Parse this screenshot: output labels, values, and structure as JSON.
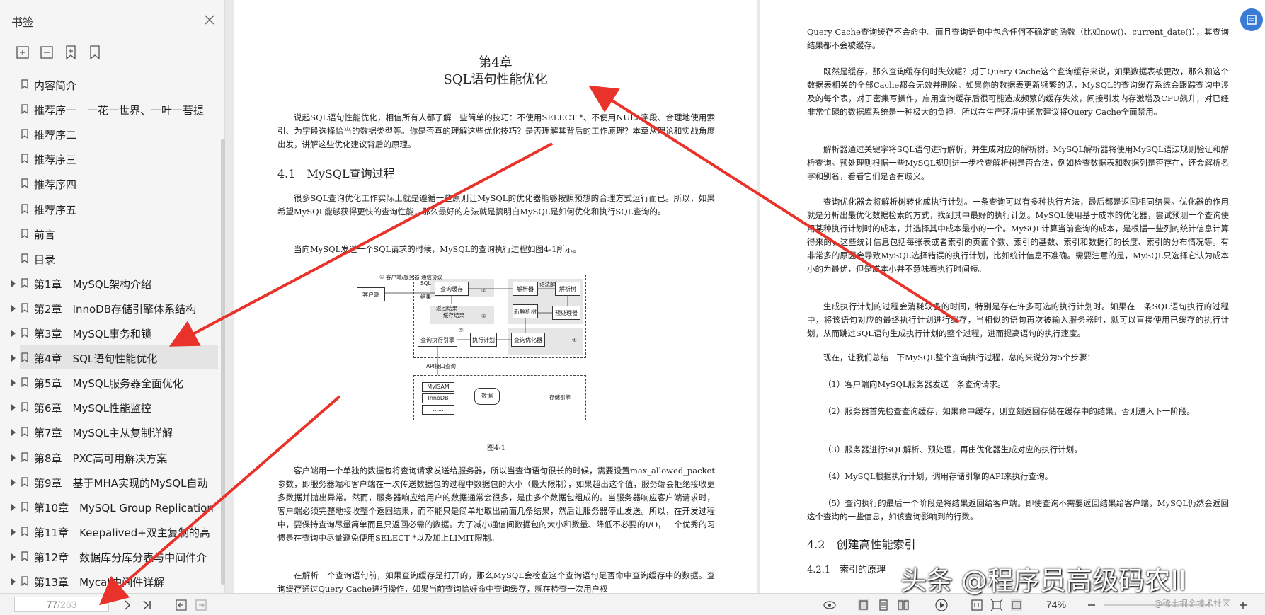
{
  "sidebar": {
    "title": "书签",
    "bookmarks": [
      {
        "label": "内容简介",
        "expandable": false
      },
      {
        "label": "推荐序一　一花一世界、一叶一菩提",
        "expandable": false
      },
      {
        "label": "推荐序二",
        "expandable": false
      },
      {
        "label": "推荐序三",
        "expandable": false
      },
      {
        "label": "推荐序四",
        "expandable": false
      },
      {
        "label": "推荐序五",
        "expandable": false
      },
      {
        "label": "前言",
        "expandable": false
      },
      {
        "label": "目录",
        "expandable": false
      },
      {
        "label": "第1章　MySQL架构介绍",
        "expandable": true
      },
      {
        "label": "第2章　InnoDB存储引擎体系结构",
        "expandable": true
      },
      {
        "label": "第3章　MySQL事务和锁",
        "expandable": true
      },
      {
        "label": "第4章　SQL语句性能优化",
        "expandable": true,
        "active": true
      },
      {
        "label": "第5章　MySQL服务器全面优化",
        "expandable": true
      },
      {
        "label": "第6章　MySQL性能监控",
        "expandable": true
      },
      {
        "label": "第7章　MySQL主从复制详解",
        "expandable": true
      },
      {
        "label": "第8章　PXC高可用解决方案",
        "expandable": true
      },
      {
        "label": "第9章　基于MHA实现的MySQL自动",
        "expandable": true
      },
      {
        "label": "第10章　MySQL Group Replication",
        "expandable": true
      },
      {
        "label": "第11章　Keepalived+双主复制的高",
        "expandable": true
      },
      {
        "label": "第12章　数据库分库分表与中间件介",
        "expandable": true
      },
      {
        "label": "第13章　Mycat中间件详解",
        "expandable": true
      }
    ]
  },
  "left_page": {
    "chapter": "第4章",
    "chapter_title": "SQL语句性能优化",
    "intro": "说起SQL语句性能优化，相信所有人都了解一些简单的技巧：不使用SELECT *、不使用NULL字段、合理地使用索引、为字段选择恰当的数据类型等。你是否真的理解这些优化技巧？是否理解其背后的工作原理？本章从理论和实战角度出发，讲解这些优化建议背后的原理。",
    "section": "4.1　MySQL查询过程",
    "para1": "很多SQL查询优化工作实际上就是遵循一些原则让MySQL的优化器能够按照预想的合理方式运行而已。所以，如果希望MySQL能够获得更快的查询性能，那么最好的方法就是搞明白MySQL是如何优化和执行SQL查询的。",
    "para2": "当向MySQL发送一个SQL请求的时候，MySQL的查询执行过程如图4-1所示。",
    "diagram": {
      "client": "客户端",
      "step1": "① 客户端/服务器 通信协议",
      "sql": "SQL",
      "result": "结果",
      "query_cache": "查询缓存",
      "parser": "解析器",
      "syntax_parse": "语法解析",
      "parse_tree": "解析树",
      "preprocessor": "预处理器",
      "new_parse_tree": "新解析树",
      "return_result": "返回结果",
      "cache_result": "缓存结果",
      "executor": "查询执行引擎",
      "plan": "执行计划",
      "optimizer": "查询优化器",
      "api": "API接口查询",
      "myisam": "MyISAM",
      "innodb": "InnoDB",
      "dots": "......",
      "data": "数据",
      "engine": "存储引擎",
      "n2": "②",
      "n3": "③",
      "n4": "④",
      "n5": "⑤",
      "n6": "⑥"
    },
    "caption": "图4-1",
    "para3": "客户端用一个单独的数据包将查询请求发送给服务器，所以当查询语句很长的时候，需要设置max_allowed_packet参数，即服务器端和客户端在一次传送数据包的过程中数据包的大小（最大限制），如果超出这个值，服务端会拒绝接收更多数据并抛出异常。然而，服务器响应给用户的数据通常会很多，是由多个数据包组成的。当服务器响应客户端请求时，客户端必须完整地接收整个返回结果，而不能只是简单地取出前面几条结果，然后让服务器停止发送。所以，在开发过程中，要保持查询尽量简单而且只返回必需的数据。为了减小通信间数据包的大小和数量、降低不必要的I/O，一个优秀的习惯是在查询中尽量避免使用SELECT *以及加上LIMIT限制。",
    "para4": "在解析一个查询语句前，如果查询缓存是打开的，那么MySQL会检查这个查询语句是否命中查询缓存中的数据。查询缓存通过Query Cache进行操作，如果当前查询恰好命中查询缓存，就在检查一次用户权"
  },
  "right_page": {
    "p0": "Query Cache查询缓存不会命中。而且查询语句中包含任何不确定的函数（比如now()、current_date()），其查询结果都不会被缓存。",
    "p1": "既然是缓存，那么查询缓存何时失效呢？对于Query Cache这个查询缓存来说，如果数据表被更改，那么和这个数据表相关的全部Cache都会无效并删除。如果你的数据表更新频繁的话，MySQL的查询缓存系统会跟踪查询中涉及的每个表，对于密集写操作，启用查询缓存后很可能造成频繁的缓存失效，间接引发内存激增及CPU飙升，对已经非常忙碌的数据库系统是一种极大的负担。所以在生产环境中通常建议将Query Cache全面禁用。",
    "p2": "解析器通过关键字将SQL语句进行解析，并生成对应的解析树。MySQL解析器将使用MySQL语法规则验证和解析查询。预处理则根据一些MySQL规则进一步检查解析树是否合法，例如检查数据表和数据列是否存在，还会解析名字和别名，看看它们是否有歧义。",
    "p3": "查询优化器会将解析树转化成执行计划。一条查询可以有多种执行方法，最后都是返回相同结果。优化器的作用就是分析出最优化数据检索的方式，找到其中最好的执行计划。MySQL使用基于成本的优化器，尝试预测一个查询使用某种执行计划时的成本，并选择其中成本最小的一个。MySQL计算当前查询的成本，是根据一些列的统计信息计算得来的，这些统计信息包括每张表或者索引的页面个数、索引的基数、索引和数据行的长度、索引的分布情况等。有非常多的原因会导致MySQL选择错误的执行计划，比如统计信息不准确。需要注意的是，MySQL只选择它认为成本小的为最优，但是成本小并不意味着执行时间短。",
    "p4": "生成执行计划的过程会消耗较多的时间，特别是存在许多可选的执行计划时。如果在一条SQL语句执行的过程中，将该语句对应的最终执行计划进行缓存，当相似的语句再次被输入服务器时，就可以直接使用已缓存的执行计划，从而跳过SQL语句生成执行计划的整个过程，进而提高语句的执行速度。",
    "p5": "现在，让我们总结一下MySQL整个查询执行过程，总的来说分为5个步骤：",
    "s1": "（1）客户端向MySQL服务器发送一条查询请求。",
    "s2": "（2）服务器首先检查查询缓存，如果命中缓存，则立刻返回存储在缓存中的结果，否则进入下一阶段。",
    "s3": "（3）服务器进行SQL解析、预处理，再由优化器生成对应的执行计划。",
    "s4": "（4）MySQL根据执行计划，调用存储引擎的API来执行查询。",
    "s5": "（5）查询执行的最后一个阶段是将结果返回给客户端。即使查询不需要返回结果给客户端，MySQL仍然会返回这个查询的一些信息，如该查询影响到的行数。",
    "section": "4.2　创建高性能索引",
    "subsection": "4.2.1　索引的原理"
  },
  "bottombar": {
    "current_page": "77",
    "total_pages": "/263",
    "zoom": "74%"
  },
  "watermark": "头条 @程序员高级码农II",
  "watermark2": "@稀土掘金技术社区",
  "colors": {
    "arrow": "#e8322a",
    "accent": "#3a7bd5",
    "active_row": "#e4e4e4"
  }
}
